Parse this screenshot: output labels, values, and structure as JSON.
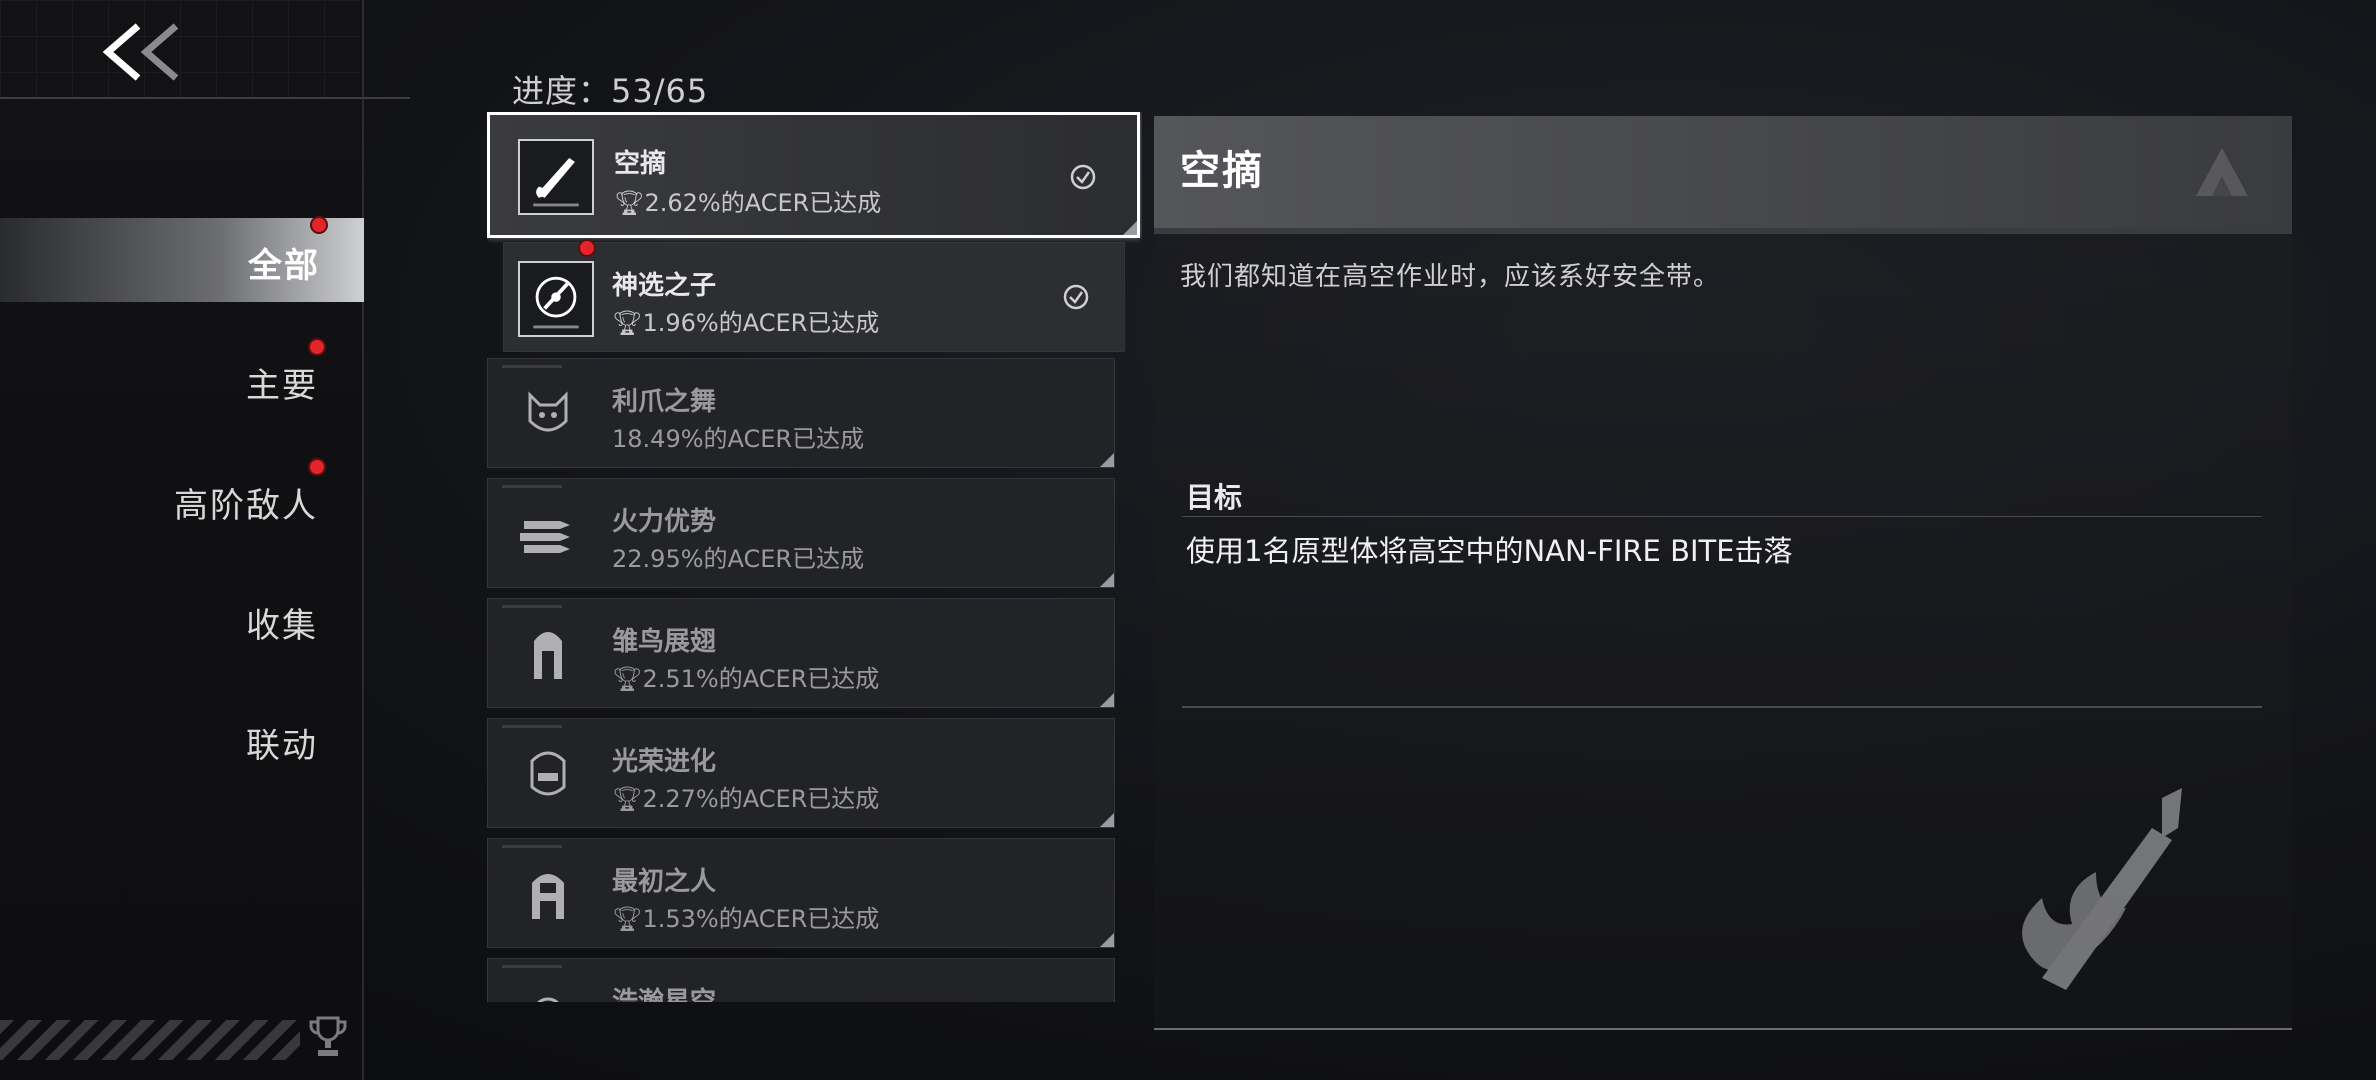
{
  "nav": {
    "categories": [
      {
        "label": "全部",
        "active": true,
        "badge": true
      },
      {
        "label": "主要",
        "active": false,
        "badge": true
      },
      {
        "label": "高阶敌人",
        "active": false,
        "badge": true
      },
      {
        "label": "收集",
        "active": false,
        "badge": false
      },
      {
        "label": "联动",
        "active": false,
        "badge": false
      }
    ]
  },
  "progress_text": "进度：53/65",
  "achievements": [
    {
      "name": "空摘",
      "percent": "2.62%的ACER已达成",
      "state": "selected",
      "icon": "rifle-icon",
      "trophy": true,
      "completed": true,
      "badge": false
    },
    {
      "name": "神选之子",
      "percent": "1.96%的ACER已达成",
      "state": "unlocked",
      "icon": "crosshair-icon",
      "trophy": true,
      "completed": true,
      "badge": true
    },
    {
      "name": "利爪之舞",
      "percent": "18.49%的ACER已达成",
      "state": "locked",
      "icon": "cat-icon",
      "trophy": false,
      "completed": false,
      "badge": false
    },
    {
      "name": "火力优势",
      "percent": "22.95%的ACER已达成",
      "state": "locked",
      "icon": "missiles-icon",
      "trophy": false,
      "completed": false,
      "badge": false
    },
    {
      "name": "雏鸟展翅",
      "percent": "2.51%的ACER已达成",
      "state": "locked",
      "icon": "girl-icon",
      "trophy": true,
      "completed": false,
      "badge": false
    },
    {
      "name": "光荣进化",
      "percent": "2.27%的ACER已达成",
      "state": "locked",
      "icon": "robot-head-icon",
      "trophy": true,
      "completed": false,
      "badge": false
    },
    {
      "name": "最初之人",
      "percent": "1.53%的ACER已达成",
      "state": "locked",
      "icon": "helmet-girl-icon",
      "trophy": true,
      "completed": false,
      "badge": false
    },
    {
      "name": "浩瀚星空",
      "percent": "",
      "state": "locked",
      "icon": "planet-icon",
      "trophy": false,
      "completed": false,
      "badge": false
    }
  ],
  "detail": {
    "title": "空摘",
    "description": "我们都知道在高空作业时，应该系好安全带。",
    "goal_label": "目标",
    "goal_text": "使用1名原型体将高空中的NAN-FIRE BITE击落"
  },
  "colors": {
    "badge": "#e2242b",
    "selected_border": "#ffffff"
  }
}
